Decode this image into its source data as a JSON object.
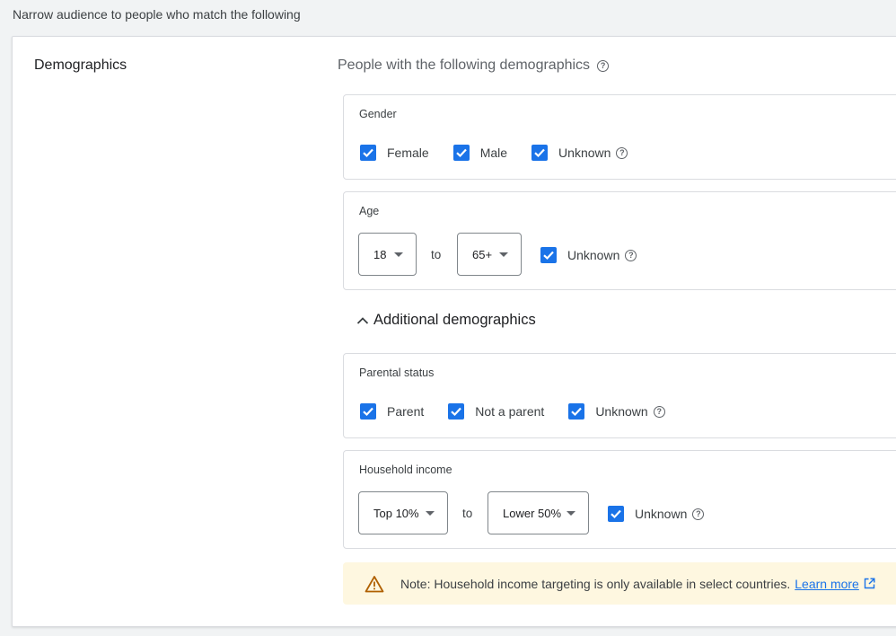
{
  "intro_text": "Narrow audience to people who match the following",
  "section": {
    "title": "Demographics",
    "heading": "People with the following demographics"
  },
  "gender": {
    "label": "Gender",
    "options": [
      {
        "label": "Female",
        "checked": true
      },
      {
        "label": "Male",
        "checked": true
      },
      {
        "label": "Unknown",
        "checked": true
      }
    ]
  },
  "age": {
    "label": "Age",
    "from": "18",
    "to_word": "to",
    "to": "65+",
    "unknown_label": "Unknown",
    "unknown_checked": true
  },
  "additional": {
    "title": "Additional demographics",
    "expanded": true
  },
  "parental": {
    "label": "Parental status",
    "options": [
      {
        "label": "Parent",
        "checked": true
      },
      {
        "label": "Not a parent",
        "checked": true
      },
      {
        "label": "Unknown",
        "checked": true
      }
    ]
  },
  "income": {
    "label": "Household income",
    "from": "Top 10%",
    "to_word": "to",
    "to": "Lower 50%",
    "unknown_label": "Unknown",
    "unknown_checked": true
  },
  "note": {
    "text": "Note: Household income targeting is only available in select countries.",
    "link": "Learn more"
  },
  "colors": {
    "accent": "#1a73e8",
    "warning": "#b06000",
    "note_bg": "#fef7e0"
  }
}
